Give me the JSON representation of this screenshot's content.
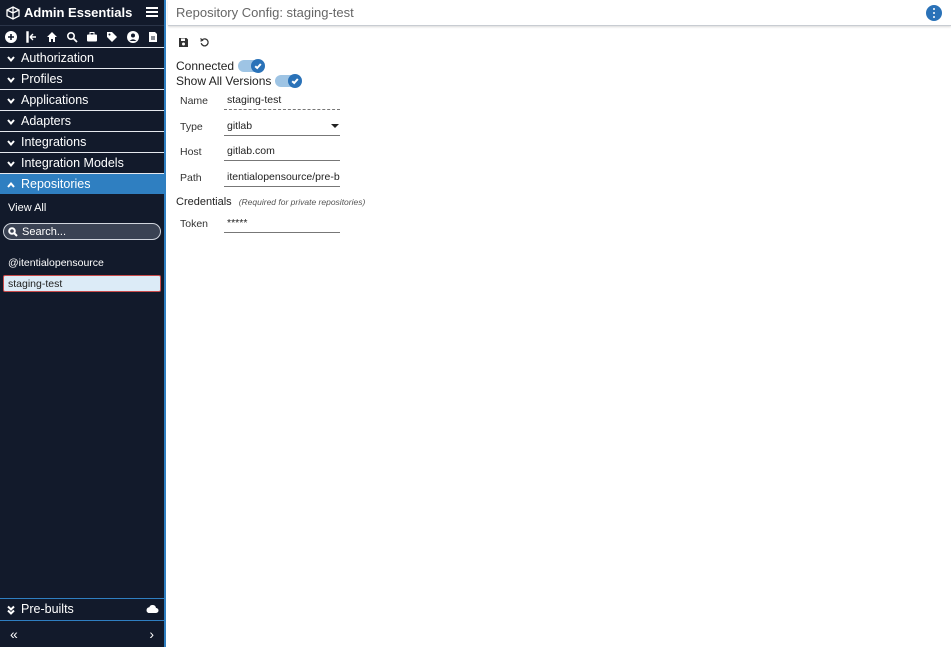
{
  "app": {
    "title": "Admin Essentials"
  },
  "sidebar": {
    "nav": [
      {
        "label": "Authorization",
        "active": false
      },
      {
        "label": "Profiles",
        "active": false
      },
      {
        "label": "Applications",
        "active": false
      },
      {
        "label": "Adapters",
        "active": false
      },
      {
        "label": "Integrations",
        "active": false
      },
      {
        "label": "Integration Models",
        "active": false
      },
      {
        "label": "Repositories",
        "active": true
      }
    ],
    "view_all": "View All",
    "search": {
      "placeholder": "Search..."
    },
    "group": "@itentialopensource",
    "selected_repo": "staging-test",
    "prebuilts": "Pre-builts",
    "footer": {
      "collapse": "«",
      "expand": "›"
    }
  },
  "header": {
    "title": "Repository Config: staging-test"
  },
  "form": {
    "connected_label": "Connected",
    "connected": true,
    "show_all_label": "Show All Versions",
    "show_all": true,
    "fields": [
      {
        "label": "Name",
        "value": "staging-test"
      },
      {
        "label": "Type",
        "value": "gitlab"
      },
      {
        "label": "Host",
        "value": "gitlab.com"
      },
      {
        "label": "Path",
        "value": "itentialopensource/pre-bu"
      }
    ],
    "credentials_label": "Credentials",
    "credentials_hint": "(Required for private repositories)",
    "token_label": "Token",
    "token_value": "*****"
  },
  "colors": {
    "sidebar_bg": "#121a2b",
    "accent": "#2f7fc1",
    "toggle_knob": "#2a72b8"
  }
}
